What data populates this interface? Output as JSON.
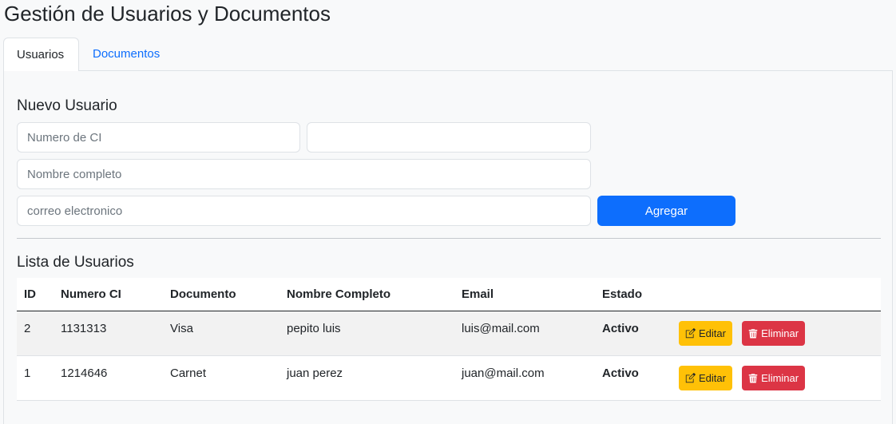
{
  "header": {
    "title": "Gestión de Usuarios y Documentos"
  },
  "tabs": [
    {
      "label": "Usuarios",
      "active": true
    },
    {
      "label": "Documentos",
      "active": false
    }
  ],
  "form": {
    "title": "Nuevo Usuario",
    "ci_placeholder": "Numero de CI",
    "ci_value": "",
    "doc_placeholder": "",
    "doc_value": "",
    "name_placeholder": "Nombre completo",
    "email_placeholder": "correo electronico",
    "submit_label": "Agregar"
  },
  "list": {
    "title": "Lista de Usuarios",
    "columns": [
      "ID",
      "Numero CI",
      "Documento",
      "Nombre Completo",
      "Email",
      "Estado",
      ""
    ],
    "rows": [
      {
        "id": "2",
        "ci": "1131313",
        "documento": "Visa",
        "nombre": "pepito luis",
        "email": "luis@mail.com",
        "estado": "Activo",
        "edit_label": "Editar",
        "delete_label": "Eliminar"
      },
      {
        "id": "1",
        "ci": "1214646",
        "documento": "Carnet",
        "nombre": "juan perez",
        "email": "juan@mail.com",
        "estado": "Activo",
        "edit_label": "Editar",
        "delete_label": "Eliminar"
      }
    ]
  },
  "icons": {
    "edit": "pencil-square-icon",
    "delete": "trash-icon"
  },
  "colors": {
    "primary": "#0d6efd",
    "warning": "#ffc107",
    "danger": "#dc3545"
  }
}
